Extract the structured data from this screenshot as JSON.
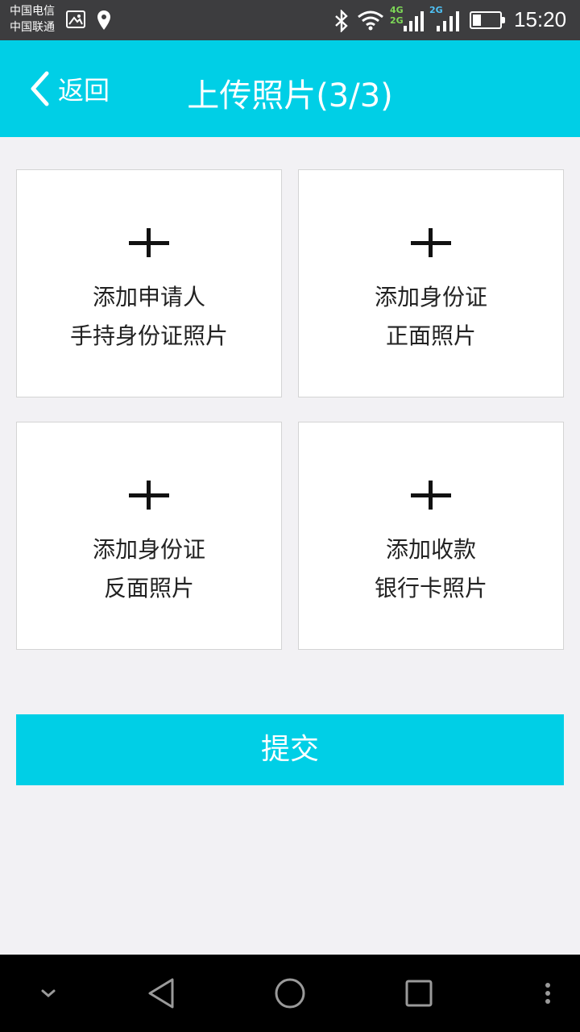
{
  "status_bar": {
    "carrier1": "中国电信",
    "carrier2": "中国联通",
    "network1_top": "4G",
    "network1_bottom": "2G",
    "network2": "2G",
    "battery_level": 0.3,
    "time": "15:20"
  },
  "header": {
    "back_label": "返回",
    "title": "上传照片(3/3)"
  },
  "tiles": [
    {
      "line1": "添加申请人",
      "line2": "手持身份证照片"
    },
    {
      "line1": "添加身份证",
      "line2": "正面照片"
    },
    {
      "line1": "添加身份证",
      "line2": "反面照片"
    },
    {
      "line1": "添加收款",
      "line2": "银行卡照片"
    }
  ],
  "submit_label": "提交",
  "colors": {
    "accent": "#00cfe6",
    "status_bar": "#3d3d3f",
    "background": "#f2f1f4",
    "nav_bar": "#000000"
  },
  "icons": {
    "back": "chevron-left-icon",
    "add": "plus-icon",
    "nav": [
      "chevron-down-icon",
      "back-triangle-icon",
      "home-circle-icon",
      "recents-square-icon",
      "more-vertical-icon"
    ]
  }
}
